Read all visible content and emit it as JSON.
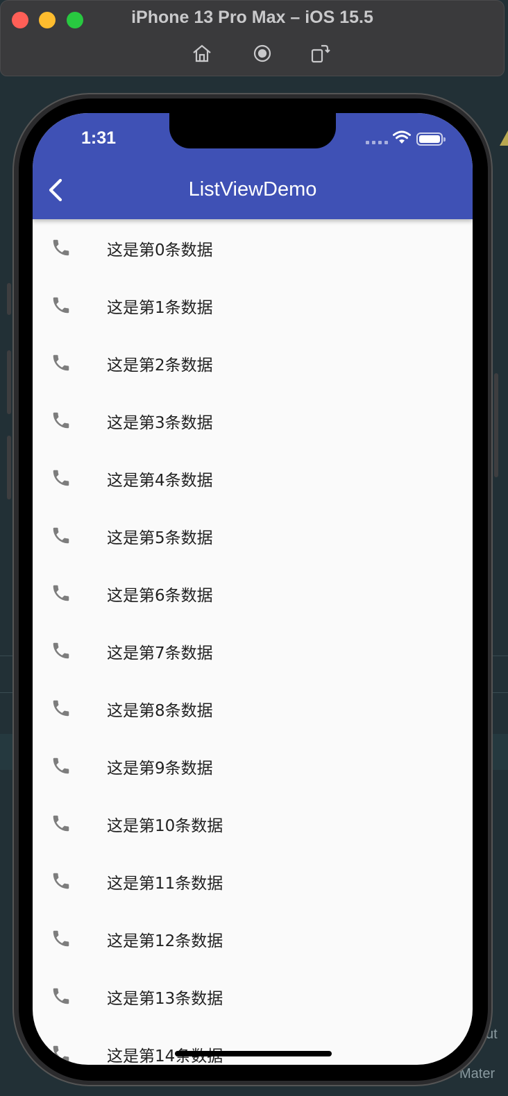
{
  "simulator": {
    "title": "iPhone 13 Pro Max – iOS 15.5",
    "toolbar": [
      "home-icon",
      "screenshot-icon",
      "rotate-icon"
    ]
  },
  "status_bar": {
    "time": "1:31"
  },
  "app_bar": {
    "title": "ListViewDemo",
    "back_icon": "chevron-left-icon",
    "color": "#3f51b5"
  },
  "list": {
    "item_icon": "phone-icon",
    "items": [
      "这是第0条数据",
      "这是第1条数据",
      "这是第2条数据",
      "这是第3条数据",
      "这是第4条数据",
      "这是第5条数据",
      "这是第6条数据",
      "这是第7条数据",
      "这是第8条数据",
      "这是第9条数据",
      "这是第10条数据",
      "这是第11条数据",
      "这是第12条数据",
      "这是第13条数据",
      "这是第14条数据"
    ]
  },
  "ide_background": {
    "fragments": [
      "ut",
      "Mater"
    ]
  }
}
